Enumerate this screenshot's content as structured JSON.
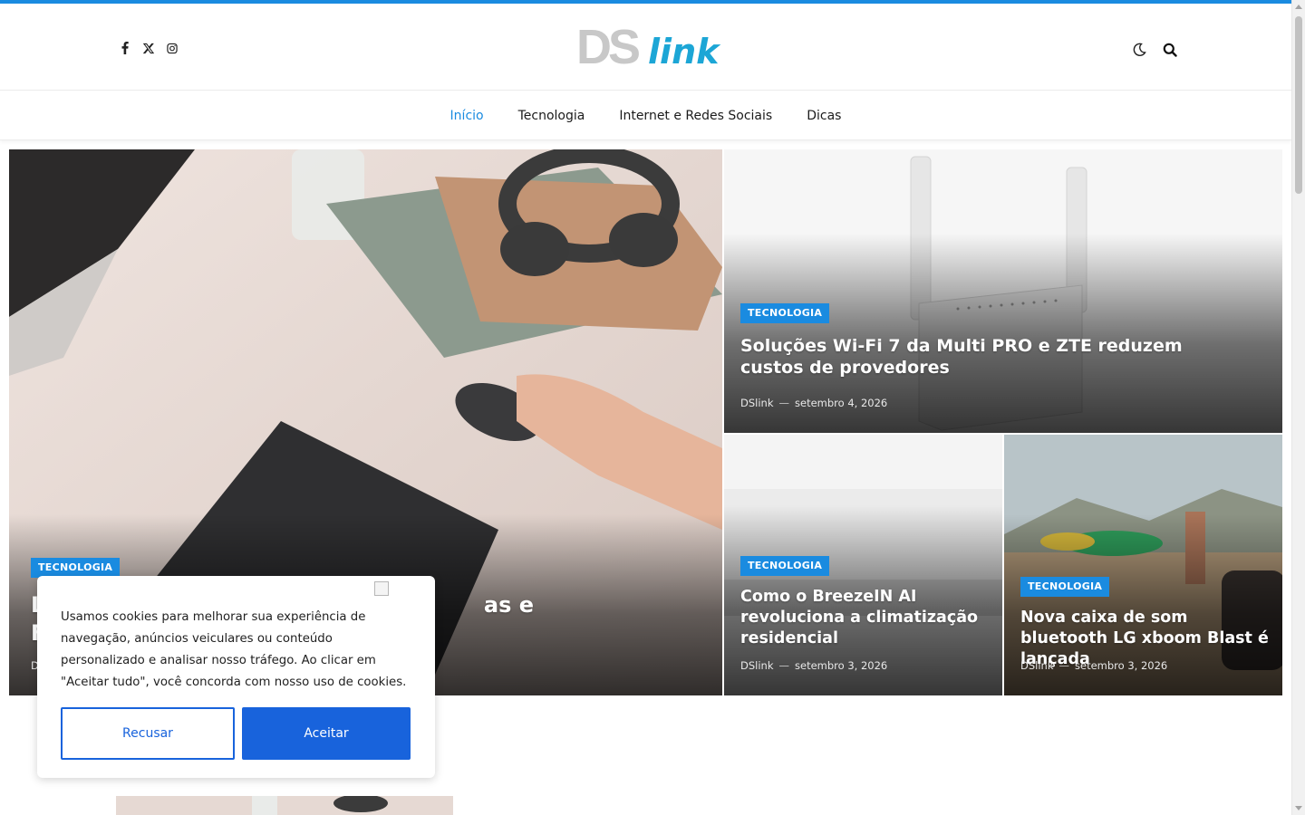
{
  "colors": {
    "accent": "#1a8be0",
    "cookie_button": "#1863dc",
    "logo_ds": "#c8c8c8",
    "logo_link": "#1ca6d6"
  },
  "header": {
    "social": [
      {
        "icon": "facebook-icon"
      },
      {
        "icon": "x-twitter-icon"
      },
      {
        "icon": "instagram-icon"
      }
    ],
    "logo": {
      "part1": "DS",
      "part2": "link"
    },
    "tools": [
      {
        "icon": "dark-mode-moon-icon"
      },
      {
        "icon": "search-icon"
      }
    ]
  },
  "nav": {
    "items": [
      {
        "label": "Início",
        "active": true
      },
      {
        "label": "Tecnologia",
        "active": false
      },
      {
        "label": "Internet e Redes Sociais",
        "active": false
      },
      {
        "label": "Dicas",
        "active": false
      }
    ]
  },
  "featured": {
    "main": {
      "category": "TECNOLOGIA",
      "title_visible": "L                                                          as e\nF",
      "meta_author_visible": "D"
    },
    "card1": {
      "category": "TECNOLOGIA",
      "title": "Soluções Wi-Fi 7 da Multi PRO e ZTE reduzem custos de provedores",
      "author": "DSlink",
      "date": "setembro 4, 2026"
    },
    "card2": {
      "category": "TECNOLOGIA",
      "title": "Como o BreezeIN AI revoluciona a climatização residencial",
      "author": "DSlink",
      "date": "setembro 3, 2026"
    },
    "card3": {
      "category": "TECNOLOGIA",
      "title": "Nova caixa de som bluetooth LG xboom Blast é lançada",
      "author": "DSlink",
      "date": "setembro 3, 2026"
    }
  },
  "cookie": {
    "text": "Usamos cookies para melhorar sua experiência de navegação, anúncios veiculares ou conteúdo personalizado e analisar nosso tráfego. Ao clicar em \"Aceitar tudo\", você concorda com nosso uso de cookies.",
    "reject_label": "Recusar",
    "accept_label": "Aceitar"
  },
  "meta_separator": "—"
}
